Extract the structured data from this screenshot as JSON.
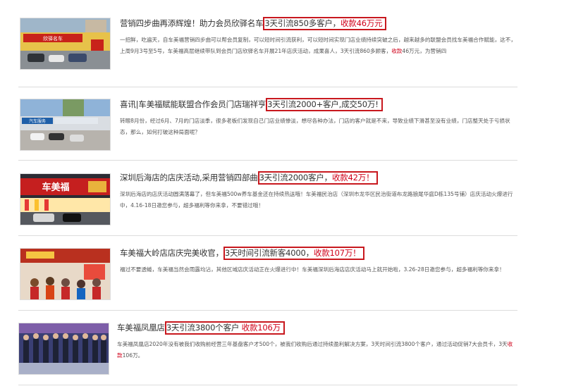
{
  "articles": [
    {
      "title_pre": "营销四步曲再添辉煌！助力会员欣驿名车",
      "title_hl_a": "3天引流850多客户，",
      "title_hl_red": "收款46万元",
      "title_hl_b": "",
      "desc_a": "一招鲜，吃遍天，自车美福营销四步曲可以帮会员复制，可以短时间引流获利，可以短时间实现门店业绩持续突破之后，越来越多的联盟会员找车美福合作赋能，这不，上周9月3号至5号，车美福高层继续带队到会员门店欣驿名车开展21年店庆活动，成果喜人，3天引流860多顾客，",
      "desc_red": "收款",
      "desc_b": "46万元，为营销四",
      "thumb_sign": "欣驿名车"
    },
    {
      "title_pre": "喜讯|车美福赋能联盟合作会员门店瑞祥亨",
      "title_hl_a": "3天引流",
      "title_hl_red": "",
      "title_hl_b": "2000+客户,成交50万!",
      "desc_a": "转眼8月份，经过6月、7月的门店淡季，很多老板们发现自己门店业绩惨淡，想尽各种办法，门店的客户就是不来，导致业绩下滑甚至没有业绩，门店整天处于亏损状态，那么，如何打破这种局面呢？",
      "desc_red": "",
      "desc_b": "",
      "thumb_sign": "汽车服务"
    },
    {
      "title_pre": "深圳后海店的店庆活动,采用营销四部曲",
      "title_hl_a": "3天引流2000客户，",
      "title_hl_red": "收款42万！",
      "title_hl_b": "",
      "desc_a": "深圳后海店的店庆活动圆满落幕了，但车美福500w养车基金还在持续热送哦！车美福民治店（深圳市龙华区民治街道布龙路狼尾华庭D栋135号铺）店庆活动火爆进行中，4.16-18日邀您参与，超多福利等你来拿，不要错过哦！",
      "desc_red": "",
      "desc_b": "",
      "thumb_sign": "车美福"
    },
    {
      "title_pre": "车美福大岭店店庆完美收官，",
      "title_hl_a": "3天时间引流新客4000，",
      "title_hl_red": "收款107万！",
      "title_hl_b": "",
      "desc_a": "福过不要透蜷，车美福当然会雨露均沾，其他区域店庆活动正在火爆进行中！车美福深圳后海店店庆活动马上就开始啦，3.26-28日邀您参与，超多福利等你来拿！",
      "desc_red": "",
      "desc_b": "",
      "thumb_sign": ""
    },
    {
      "title_pre": "车美福凤凰店",
      "title_hl_a": "3天引流3800个客户 ",
      "title_hl_red": "收款106万",
      "title_hl_b": "",
      "desc_a": "车美福凤凰店2020年没有被我们收购前经营三年基盘客户才500个，被我们收购后通过持续盈利解决方案，3天时间引流3800个客户，通过活动促销7大会员卡，3天",
      "desc_red": "收款",
      "desc_b": "106万。",
      "thumb_sign": ""
    }
  ],
  "colors": {
    "highlight_border": "#c8181e",
    "accent_red": "#d0021b",
    "divider": "#dcdcdc"
  }
}
